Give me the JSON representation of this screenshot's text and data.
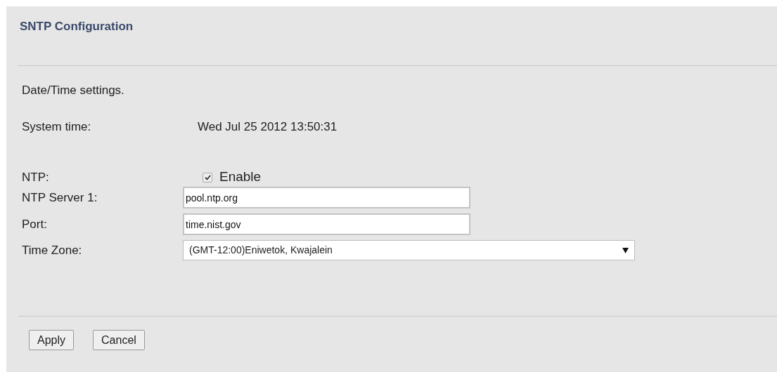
{
  "title": "SNTP Configuration",
  "intro": "Date/Time settings.",
  "system_time": {
    "label": "System time:",
    "value": "Wed Jul 25 2012 13:50:31"
  },
  "ntp": {
    "label": "NTP:",
    "checkbox_label": "Enable",
    "checked": true
  },
  "fields": [
    {
      "kind": "text",
      "label": "NTP Server 1:",
      "value": "pool.ntp.org"
    },
    {
      "kind": "text",
      "label": "Port:",
      "value": "time.nist.gov"
    },
    {
      "kind": "select",
      "label": "Time Zone:",
      "value": "(GMT-12:00)Eniwetok, Kwajalein"
    }
  ],
  "buttons": [
    "Apply",
    "Cancel"
  ]
}
